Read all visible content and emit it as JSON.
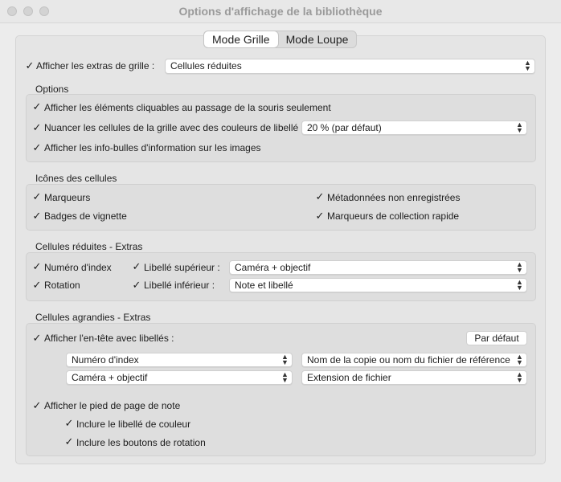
{
  "window": {
    "title": "Options d'affichage de la bibliothèque"
  },
  "tabs": [
    {
      "label": "Mode Grille",
      "active": true
    },
    {
      "label": "Mode Loupe",
      "active": false
    }
  ],
  "grid_extras": {
    "checkbox_label": "Afficher les extras de grille :",
    "checked": true,
    "select_value": "Cellules réduites"
  },
  "options": {
    "title": "Options",
    "clickable_label": "Afficher les éléments cliquables au passage de la souris seulement",
    "tint_label": "Nuancer les cellules de la grille avec des couleurs de libellé",
    "tint_select": "20 % (par défaut)",
    "tooltips_label": "Afficher les info-bulles d'information sur les images"
  },
  "cell_icons": {
    "title": "Icônes des cellules",
    "flags": "Marqueurs",
    "thumbnail_badges": "Badges de vignette",
    "unsaved_metadata": "Métadonnées non enregistrées",
    "quick_collection": "Marqueurs de collection rapide"
  },
  "compact_extras": {
    "title": "Cellules réduites - Extras",
    "index_number": "Numéro d'index",
    "rotation": "Rotation",
    "top_label": "Libellé supérieur :",
    "top_label_value": "Caméra + objectif",
    "bottom_label": "Libellé inférieur :",
    "bottom_label_value": "Note et libellé"
  },
  "expanded_extras": {
    "title": "Cellules agrandies - Extras",
    "header_label": "Afficher l'en-tête avec libellés :",
    "default_button": "Par défaut",
    "select_1": "Numéro d'index",
    "select_2": "Nom de la copie ou nom du fichier de référence",
    "select_3": "Caméra + objectif",
    "select_4": "Extension de fichier",
    "footer_label": "Afficher le pied de page de note",
    "include_color_label": "Inclure le libellé de couleur",
    "include_rotation_buttons": "Inclure les boutons de rotation"
  },
  "icons": {
    "check": "✓",
    "select_arrows": "⌃⌄"
  }
}
